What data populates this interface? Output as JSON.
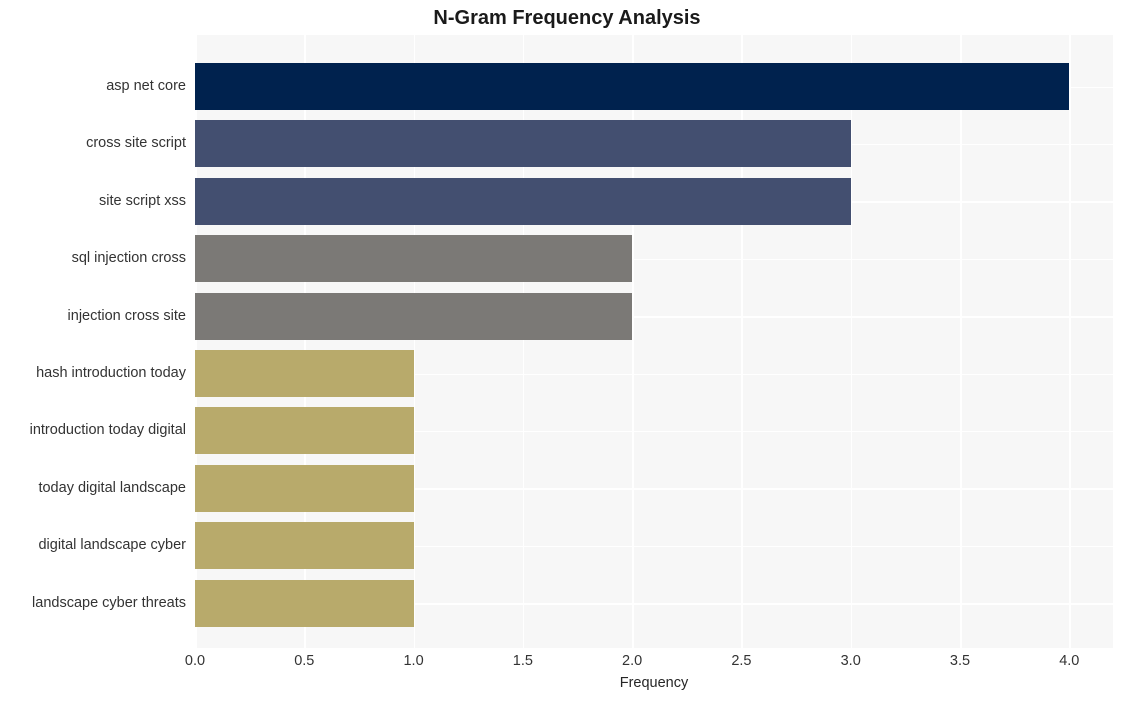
{
  "chart_data": {
    "type": "bar",
    "orientation": "horizontal",
    "title": "N-Gram Frequency Analysis",
    "xlabel": "Frequency",
    "ylabel": "",
    "categories": [
      "asp net core",
      "cross site script",
      "site script xss",
      "sql injection cross",
      "injection cross site",
      "hash introduction today",
      "introduction today digital",
      "today digital landscape",
      "digital landscape cyber",
      "landscape cyber threats"
    ],
    "values": [
      4,
      3,
      3,
      2,
      2,
      1,
      1,
      1,
      1,
      1
    ],
    "bar_colors": [
      "#00224e",
      "#434f70",
      "#434f70",
      "#7b7976",
      "#7b7976",
      "#b8aa6b",
      "#b8aa6b",
      "#b8aa6b",
      "#b8aa6b",
      "#b8aa6b"
    ],
    "xlim": [
      0.0,
      4.2
    ],
    "xticks": [
      0.0,
      0.5,
      1.0,
      1.5,
      2.0,
      2.5,
      3.0,
      3.5,
      4.0
    ],
    "xtick_labels": [
      "0.0",
      "0.5",
      "1.0",
      "1.5",
      "2.0",
      "2.5",
      "3.0",
      "3.5",
      "4.0"
    ],
    "grid": true,
    "grid_color": "#ffffff",
    "plot_background": "#f7f7f7",
    "figure_background": "#ffffff",
    "legend": null
  }
}
